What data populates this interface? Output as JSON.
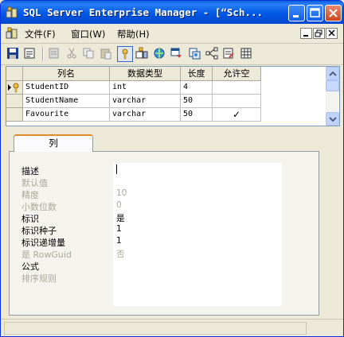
{
  "window": {
    "title": "SQL Server Enterprise Manager - [“Sch...",
    "minimize_label": "minimize",
    "maximize_label": "maximize",
    "close_label": "close"
  },
  "menu": {
    "items": [
      {
        "label": "文件(F)"
      },
      {
        "label": "窗口(W)"
      },
      {
        "label": "帮助(H)"
      }
    ]
  },
  "toolbar": {
    "icons": [
      "save-icon",
      "properties-icon",
      "generate-script-icon",
      "cut-icon",
      "copy-icon",
      "paste-icon",
      "primary-key-icon",
      "table-relationships-icon",
      "manage-indexes-icon",
      "manage-constraints-icon",
      "manage-triggers-icon",
      "relationships-icon",
      "permissions-icon",
      "table-icon"
    ]
  },
  "grid": {
    "columns": [
      "列名",
      "数据类型",
      "长度",
      "允许空"
    ],
    "rows": [
      {
        "name": "StudentID",
        "type": "int",
        "length": "4",
        "nullable": ""
      },
      {
        "name": "StudentName",
        "type": "varchar",
        "length": "50",
        "nullable": ""
      },
      {
        "name": "Favourite",
        "type": "varchar",
        "length": "50",
        "nullable": "✓"
      }
    ]
  },
  "properties": {
    "tab_label": "列",
    "fields": [
      {
        "label": "描述",
        "value": "",
        "disabled": false
      },
      {
        "label": "默认值",
        "value": "",
        "disabled": true
      },
      {
        "label": "精度",
        "value": "10",
        "disabled": true
      },
      {
        "label": "小数位数",
        "value": "0",
        "disabled": true
      },
      {
        "label": "标识",
        "value": "是",
        "disabled": false
      },
      {
        "label": "标识种子",
        "value": "1",
        "disabled": false
      },
      {
        "label": "标识递增量",
        "value": "1",
        "disabled": false
      },
      {
        "label": "是 RowGuid",
        "value": "否",
        "disabled": true
      },
      {
        "label": "公式",
        "value": "",
        "disabled": false
      },
      {
        "label": "排序规则",
        "value": "",
        "disabled": true
      }
    ]
  },
  "colors": {
    "titlebar": "#0058e6",
    "window_bg": "#ece9d8",
    "tab_accent": "#e68b2c"
  }
}
